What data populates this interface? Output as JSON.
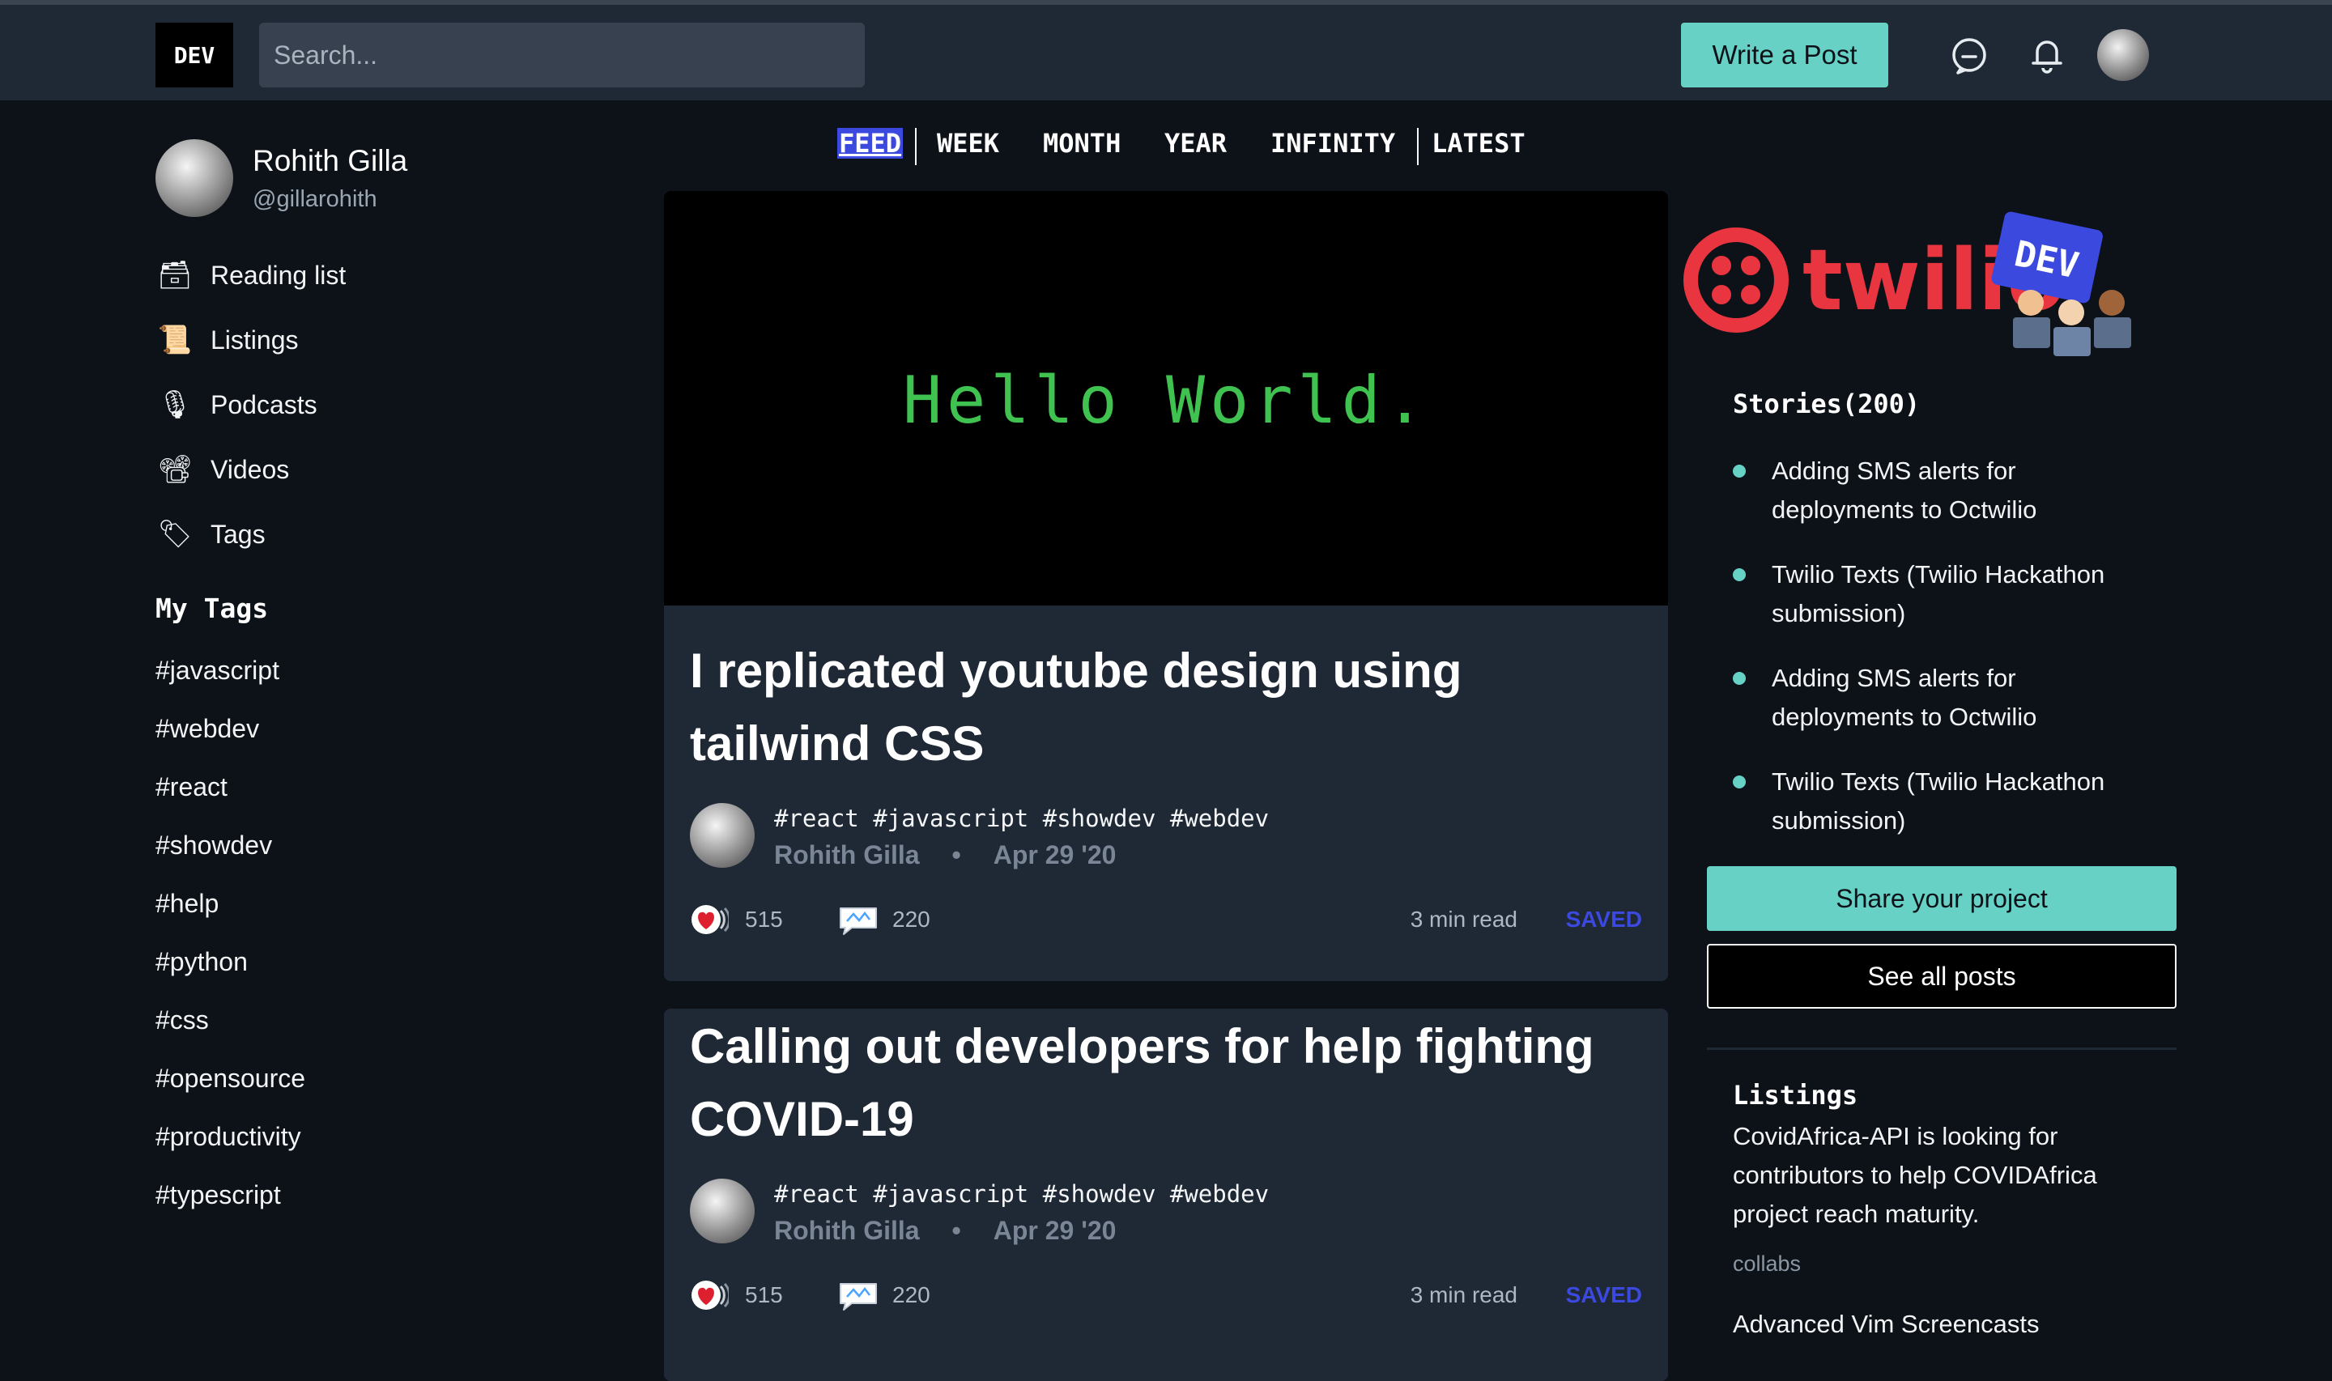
{
  "header": {
    "logo": "DEV",
    "search_placeholder": "Search...",
    "write_post": "Write a Post"
  },
  "profile": {
    "name": "Rohith Gilla",
    "handle": "@gillarohith"
  },
  "nav": [
    {
      "label": "Reading list",
      "icon": "file-cabinet-icon"
    },
    {
      "label": "Listings",
      "icon": "scroll-icon"
    },
    {
      "label": "Podcasts",
      "icon": "microphone-icon"
    },
    {
      "label": "Videos",
      "icon": "film-camera-icon"
    },
    {
      "label": "Tags",
      "icon": "tag-icon"
    }
  ],
  "my_tags": {
    "title": "My Tags",
    "items": [
      "#javascript",
      "#webdev",
      "#react",
      "#showdev",
      "#help",
      "#python",
      "#css",
      "#opensource",
      "#productivity",
      "#typescript"
    ]
  },
  "feed_tabs": [
    "FEED",
    "WEEK",
    "MONTH",
    "YEAR",
    "INFINITY",
    "LATEST"
  ],
  "articles": [
    {
      "cover_text": "Hello World.",
      "title": "I replicated youtube design using tailwind CSS",
      "tags": "#react #javascript #showdev #webdev",
      "author": "Rohith Gilla",
      "date": "Apr 29 '20",
      "reactions": "515",
      "comments": "220",
      "read_time": "3 min read",
      "saved": "SAVED"
    },
    {
      "title": "Calling out developers for help fighting COVID-19",
      "tags": "#react #javascript #showdev #webdev",
      "author": "Rohith Gilla",
      "date": "Apr 29 '20",
      "reactions": "515",
      "comments": "220",
      "read_time": "3 min read",
      "saved": "SAVED"
    }
  ],
  "sidebar": {
    "sponsor": {
      "brand": "twilio",
      "badge": "DEV"
    },
    "stories_title": "Stories(200)",
    "stories": [
      "Adding SMS alerts for deployments to Octwilio",
      "Twilio Texts (Twilio Hackathon submission)",
      "Adding SMS alerts for deployments to Octwilio",
      "Twilio Texts (Twilio Hackathon submission)"
    ],
    "share_button": "Share your project",
    "all_posts_button": "See all posts",
    "listings_title": "Listings",
    "listings": [
      {
        "text": "CovidAfrica-API is looking for contributors to help COVIDAfrica project reach maturity.",
        "category": "collabs"
      },
      {
        "text": "Advanced Vim Screencasts"
      }
    ]
  },
  "colors": {
    "background": "#0d1219",
    "card": "#1f2835",
    "accent": "#66d1c4",
    "link_blue": "#3b49df",
    "hero_green": "#3fc24f"
  }
}
